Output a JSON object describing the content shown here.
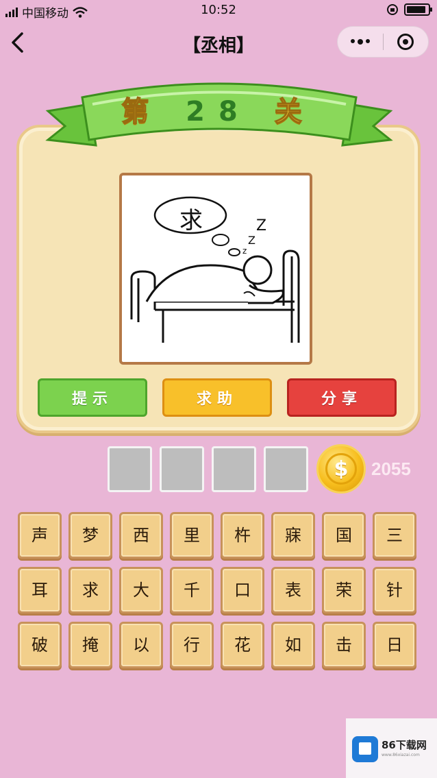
{
  "status_bar": {
    "carrier": "中国移动",
    "time": "10:52"
  },
  "nav": {
    "title": "【丞相】"
  },
  "level": {
    "prefix": "第",
    "number": "28",
    "suffix": "关"
  },
  "puzzle": {
    "bubble_text": "求"
  },
  "actions": {
    "hint_label": "提示",
    "help_label": "求助",
    "share_label": "分享"
  },
  "answer_slots": [
    "",
    "",
    "",
    ""
  ],
  "coins": {
    "count": "2055",
    "symbol": "$"
  },
  "tiles": [
    [
      "声",
      "梦",
      "西",
      "里",
      "杵",
      "寐",
      "国",
      "三"
    ],
    [
      "耳",
      "求",
      "大",
      "千",
      "口",
      "表",
      "荣",
      "针"
    ],
    [
      "破",
      "掩",
      "以",
      "行",
      "花",
      "如",
      "击",
      "日"
    ]
  ],
  "watermark": {
    "title": "86下载网",
    "subtitle": "www.86xiazai.com"
  },
  "colors": {
    "background": "#e9b6d6",
    "hint": "#7cd24e",
    "help": "#f8c02a",
    "share": "#e6423e"
  }
}
